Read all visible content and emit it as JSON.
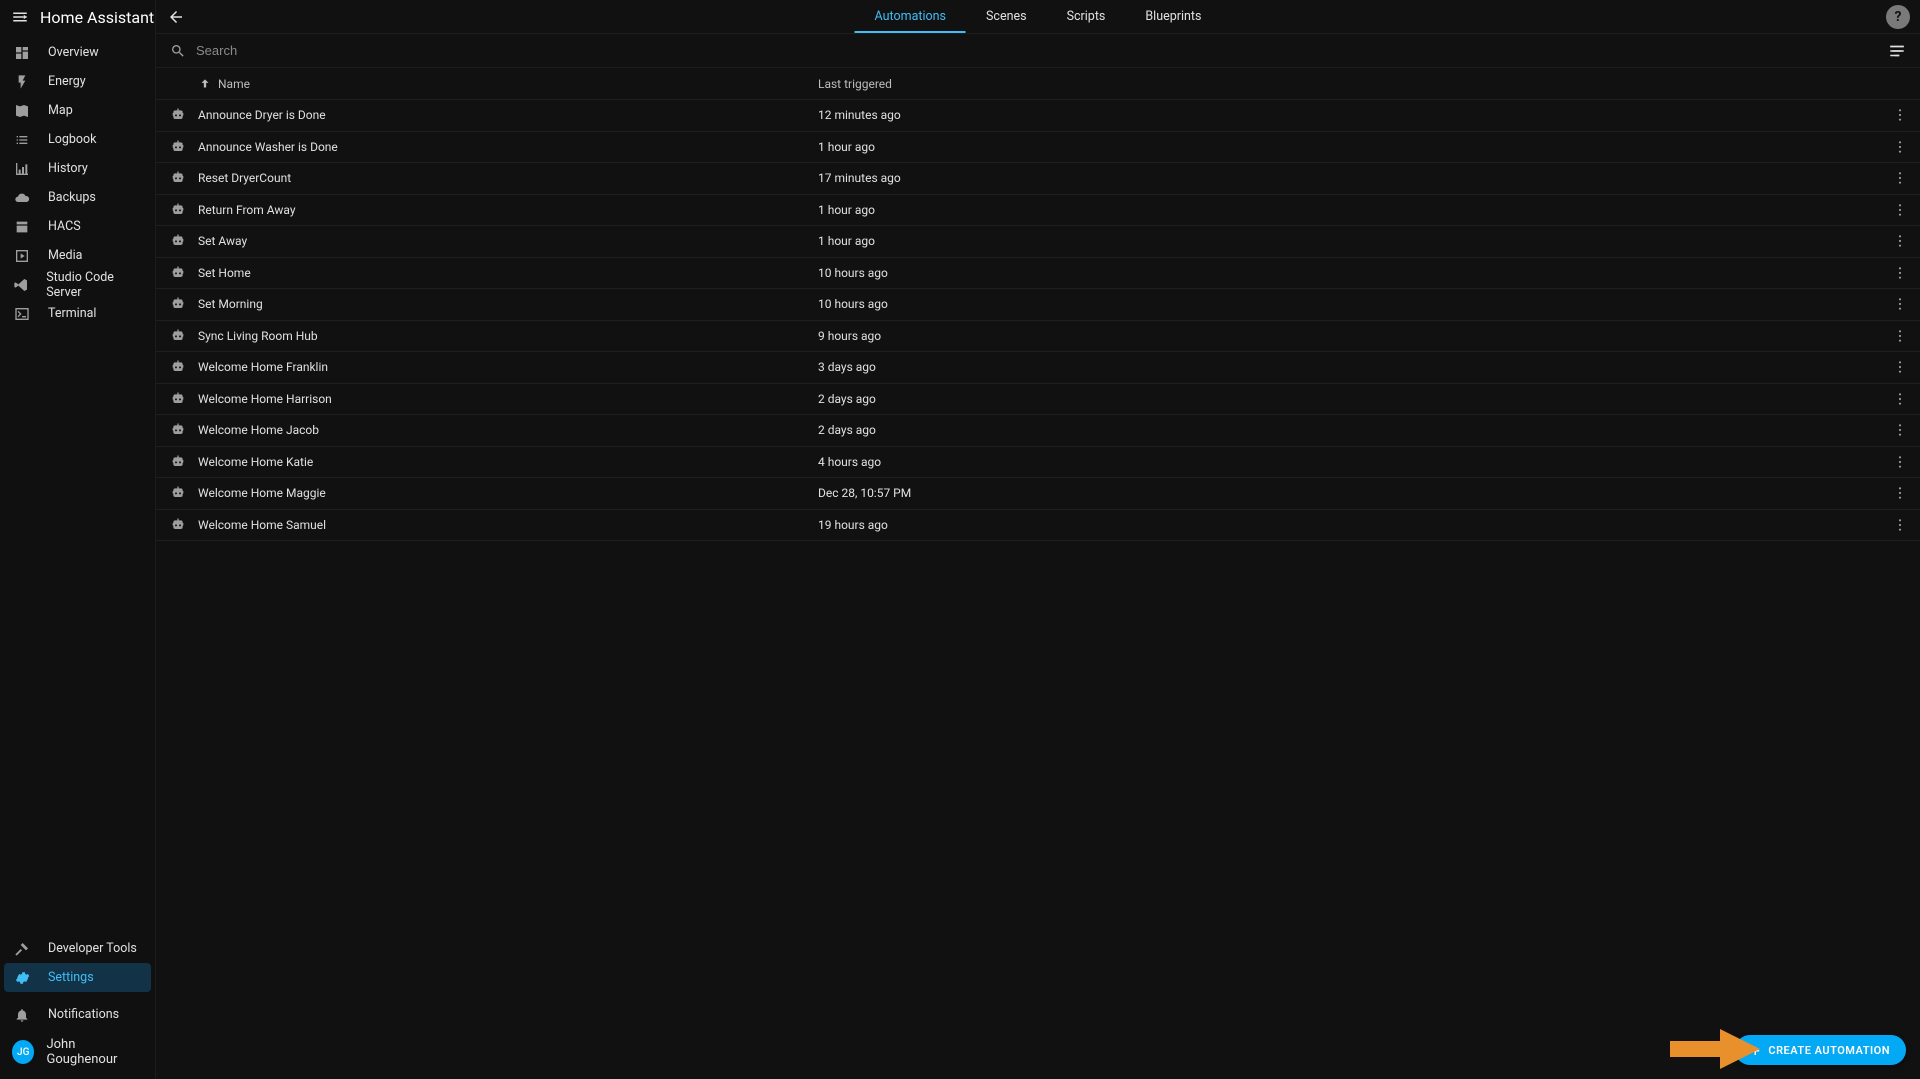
{
  "app": {
    "title": "Home Assistant"
  },
  "sidebar": {
    "items": [
      {
        "label": "Overview",
        "icon": "dashboard"
      },
      {
        "label": "Energy",
        "icon": "flash"
      },
      {
        "label": "Map",
        "icon": "map"
      },
      {
        "label": "Logbook",
        "icon": "list"
      },
      {
        "label": "History",
        "icon": "chart"
      },
      {
        "label": "Backups",
        "icon": "cloud"
      },
      {
        "label": "HACS",
        "icon": "store"
      },
      {
        "label": "Media",
        "icon": "play"
      },
      {
        "label": "Studio Code Server",
        "icon": "vscode"
      },
      {
        "label": "Terminal",
        "icon": "terminal"
      }
    ],
    "bottom": [
      {
        "label": "Developer Tools",
        "icon": "hammer",
        "active": false
      },
      {
        "label": "Settings",
        "icon": "cog",
        "active": true
      }
    ],
    "notifications_label": "Notifications",
    "user": {
      "name": "John Goughenour",
      "initials": "JG"
    }
  },
  "tabs": [
    {
      "label": "Automations",
      "active": true
    },
    {
      "label": "Scenes",
      "active": false
    },
    {
      "label": "Scripts",
      "active": false
    },
    {
      "label": "Blueprints",
      "active": false
    }
  ],
  "search": {
    "placeholder": "Search"
  },
  "columns": {
    "name": "Name",
    "last_triggered": "Last triggered"
  },
  "automations": [
    {
      "name": "Announce Dryer is Done",
      "last": "12 minutes ago"
    },
    {
      "name": "Announce Washer is Done",
      "last": "1 hour ago"
    },
    {
      "name": "Reset DryerCount",
      "last": "17 minutes ago"
    },
    {
      "name": "Return From Away",
      "last": "1 hour ago"
    },
    {
      "name": "Set Away",
      "last": "1 hour ago"
    },
    {
      "name": "Set Home",
      "last": "10 hours ago"
    },
    {
      "name": "Set Morning",
      "last": "10 hours ago"
    },
    {
      "name": "Sync Living Room Hub",
      "last": "9 hours ago"
    },
    {
      "name": "Welcome Home Franklin",
      "last": "3 days ago"
    },
    {
      "name": "Welcome Home Harrison",
      "last": "2 days ago"
    },
    {
      "name": "Welcome Home Jacob",
      "last": "2 days ago"
    },
    {
      "name": "Welcome Home Katie",
      "last": "4 hours ago"
    },
    {
      "name": "Welcome Home Maggie",
      "last": "Dec 28, 10:57 PM"
    },
    {
      "name": "Welcome Home Samuel",
      "last": "19 hours ago"
    }
  ],
  "fab": {
    "label": "CREATE AUTOMATION"
  },
  "colors": {
    "accent": "#03a9f4",
    "annotation": "#e8912c"
  }
}
